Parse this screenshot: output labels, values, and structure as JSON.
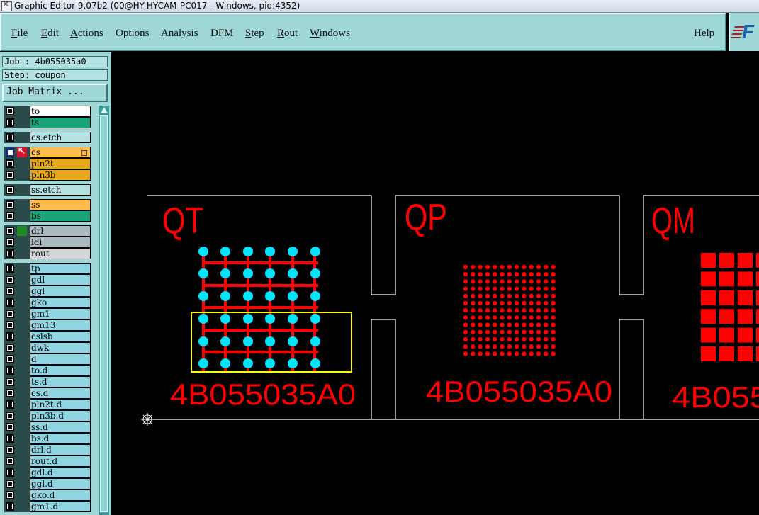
{
  "window": {
    "title": "Graphic Editor 9.07b2 (00@HY-HYCAM-PC017 - Windows, pid:4352)"
  },
  "menu": {
    "items": [
      {
        "label": "File",
        "first": "F",
        "rest": "ile"
      },
      {
        "label": "Edit",
        "first": "E",
        "rest": "dit"
      },
      {
        "label": "Actions",
        "first": "A",
        "rest": "ctions"
      },
      {
        "label": "Options",
        "first": "",
        "rest": "Options"
      },
      {
        "label": "Analysis",
        "first": "",
        "rest": "Analysis"
      },
      {
        "label": "DFM",
        "first": "",
        "rest": "DFM"
      },
      {
        "label": "Step",
        "first": "S",
        "rest": "tep"
      },
      {
        "label": "Rout",
        "first": "R",
        "rest": "out"
      },
      {
        "label": "Windows",
        "first": "W",
        "rest": "indows"
      }
    ],
    "help": "Help",
    "logo": "F"
  },
  "panel": {
    "job": "Job : 4b055035a0",
    "step": "Step: coupon",
    "matrix_button": "Job Matrix ..."
  },
  "layers": [
    [
      {
        "name": "to",
        "color": "#ffffff"
      },
      {
        "name": "ts",
        "color": "#1aa47a"
      }
    ],
    [
      {
        "name": "cs.etch",
        "color": "#b5e3e3"
      }
    ],
    [
      {
        "name": "cs",
        "color": "#ffbc4a",
        "work": true,
        "flag": "red"
      },
      {
        "name": "pln2t",
        "color": "#e6a71b"
      },
      {
        "name": "pln3b",
        "color": "#e6a71b"
      }
    ],
    [
      {
        "name": "ss.etch",
        "color": "#b5e3e3"
      }
    ],
    [
      {
        "name": "ss",
        "color": "#ffbc4a"
      },
      {
        "name": "bs",
        "color": "#1aa47a"
      }
    ],
    [
      {
        "name": "drl",
        "color": "#aab9bf",
        "flag": "green"
      },
      {
        "name": "ldi",
        "color": "#aab9bf"
      },
      {
        "name": "rout",
        "color": "#d6d6d6"
      }
    ],
    [
      {
        "name": "tp",
        "color": "#8fd4e3"
      },
      {
        "name": "gdl",
        "color": "#8fd4e3"
      },
      {
        "name": "ggl",
        "color": "#8fd4e3"
      },
      {
        "name": "gko",
        "color": "#8fd4e3"
      },
      {
        "name": "gm1",
        "color": "#8fd4e3"
      },
      {
        "name": "gm13",
        "color": "#8fd4e3"
      },
      {
        "name": "cslsb",
        "color": "#8fd4e3"
      },
      {
        "name": "dwk",
        "color": "#8fd4e3"
      },
      {
        "name": "d",
        "color": "#8fd4e3"
      },
      {
        "name": "to.d",
        "color": "#8fd4e3"
      },
      {
        "name": "ts.d",
        "color": "#8fd4e3"
      },
      {
        "name": "cs.d",
        "color": "#8fd4e3"
      },
      {
        "name": "pln2t.d",
        "color": "#8fd4e3"
      },
      {
        "name": "pln3b.d",
        "color": "#8fd4e3"
      },
      {
        "name": "ss.d",
        "color": "#8fd4e3"
      },
      {
        "name": "bs.d",
        "color": "#8fd4e3"
      },
      {
        "name": "drl.d",
        "color": "#8fd4e3"
      },
      {
        "name": "rout.d",
        "color": "#8fd4e3"
      },
      {
        "name": "gdl.d",
        "color": "#8fd4e3"
      },
      {
        "name": "ggl.d",
        "color": "#8fd4e3"
      },
      {
        "name": "gko.d",
        "color": "#8fd4e3"
      },
      {
        "name": "gm1.d",
        "color": "#8fd4e3"
      }
    ]
  ],
  "coupons": [
    {
      "label": "QT",
      "code": "4B055035A0"
    },
    {
      "label": "QP",
      "code": "4B055035A0"
    },
    {
      "label": "QM",
      "code": "4B055"
    }
  ],
  "colors": {
    "feature_red": "#ff0000",
    "pad_cyan": "#00e5ff",
    "highlight": "#ffff00",
    "profile": "#ffffff"
  }
}
